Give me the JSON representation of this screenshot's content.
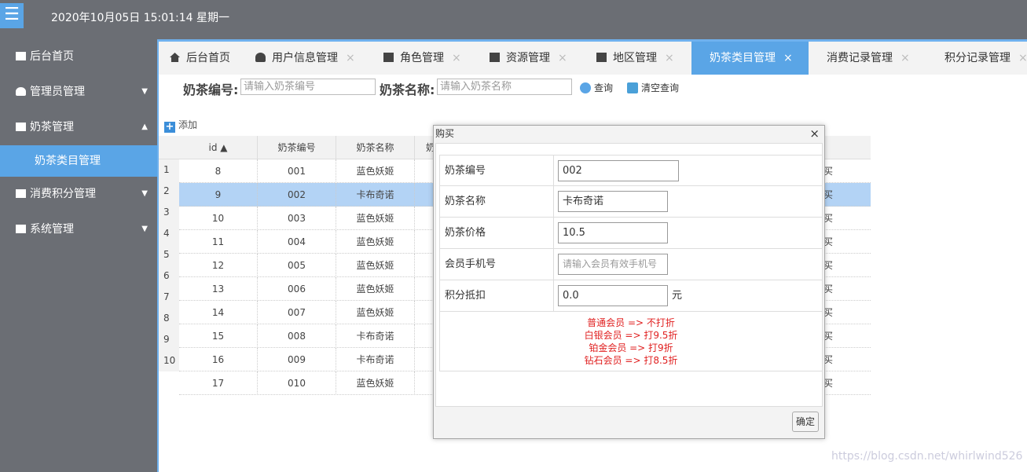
{
  "header": {
    "menu_icon": "☰",
    "datetime": "2020年10月05日 15:01:14 星期一"
  },
  "sidebar": {
    "items": [
      {
        "label": "后台首页",
        "icon": "monitor-icon",
        "arrow": ""
      },
      {
        "label": "管理员管理",
        "icon": "user-icon",
        "arrow": "▼"
      },
      {
        "label": "奶茶管理",
        "icon": "monitor-icon",
        "arrow": "▲"
      },
      {
        "label": "消费积分管理",
        "icon": "monitor-heart-icon",
        "arrow": "▼"
      },
      {
        "label": "系统管理",
        "icon": "monitor-heart-icon",
        "arrow": "▼"
      }
    ],
    "sub_item": "奶茶类目管理"
  },
  "tabs": [
    {
      "label": "后台首页",
      "icon": "home-icon",
      "close": ""
    },
    {
      "label": "用户信息管理",
      "icon": "users-icon",
      "close": "×"
    },
    {
      "label": "角色管理",
      "icon": "id-card-icon",
      "close": "×"
    },
    {
      "label": "资源管理",
      "icon": "monitor-icon",
      "close": "×"
    },
    {
      "label": "地区管理",
      "icon": "building-icon",
      "close": "×"
    },
    {
      "label": "奶茶类目管理",
      "icon": "",
      "close": "×"
    },
    {
      "label": "消费记录管理",
      "icon": "",
      "close": "×"
    },
    {
      "label": "积分记录管理",
      "icon": "",
      "close": "×"
    }
  ],
  "search": {
    "code_label": "奶茶编号:",
    "code_placeholder": "请输入奶茶编号",
    "name_label": "奶茶名称:",
    "name_placeholder": "请输入奶茶名称",
    "query_label": "查询",
    "clear_label": "清空查询"
  },
  "toolbar": {
    "add_label": "添加"
  },
  "grid": {
    "columns": [
      "id ▲",
      "奶茶编号",
      "奶茶名称",
      "奶"
    ],
    "rows": [
      {
        "n": "1",
        "id": "8",
        "code": "001",
        "name": "蓝色妖姬"
      },
      {
        "n": "2",
        "id": "9",
        "code": "002",
        "name": "卡布奇诺"
      },
      {
        "n": "3",
        "id": "10",
        "code": "003",
        "name": "蓝色妖姬"
      },
      {
        "n": "4",
        "id": "11",
        "code": "004",
        "name": "蓝色妖姬"
      },
      {
        "n": "5",
        "id": "12",
        "code": "005",
        "name": "蓝色妖姬"
      },
      {
        "n": "6",
        "id": "13",
        "code": "006",
        "name": "蓝色妖姬"
      },
      {
        "n": "7",
        "id": "14",
        "code": "007",
        "name": "蓝色妖姬"
      },
      {
        "n": "8",
        "id": "15",
        "code": "008",
        "name": "卡布奇诺"
      },
      {
        "n": "9",
        "id": "16",
        "code": "009",
        "name": "卡布奇诺"
      },
      {
        "n": "10",
        "id": "17",
        "code": "010",
        "name": "蓝色妖姬"
      }
    ],
    "action_label": "买"
  },
  "dialog": {
    "title": "购买",
    "close": "×",
    "fields": [
      {
        "label": "奶茶编号",
        "value": "002",
        "placeholder": ""
      },
      {
        "label": "奶茶名称",
        "value": "卡布奇诺",
        "placeholder": ""
      },
      {
        "label": "奶茶价格",
        "value": "10.5",
        "placeholder": ""
      },
      {
        "label": "会员手机号",
        "value": "",
        "placeholder": "请输入会员有效手机号"
      },
      {
        "label": "积分抵扣",
        "value": "0.0",
        "placeholder": "",
        "unit": "元"
      }
    ],
    "notes": [
      "普通会员 => 不打折",
      "白银会员 => 打9.5折",
      "铂金会员 => 打9折",
      "钻石会员 => 打8.5折"
    ],
    "ok_label": "确定"
  },
  "watermark": "https://blog.csdn.net/whirlwind526"
}
